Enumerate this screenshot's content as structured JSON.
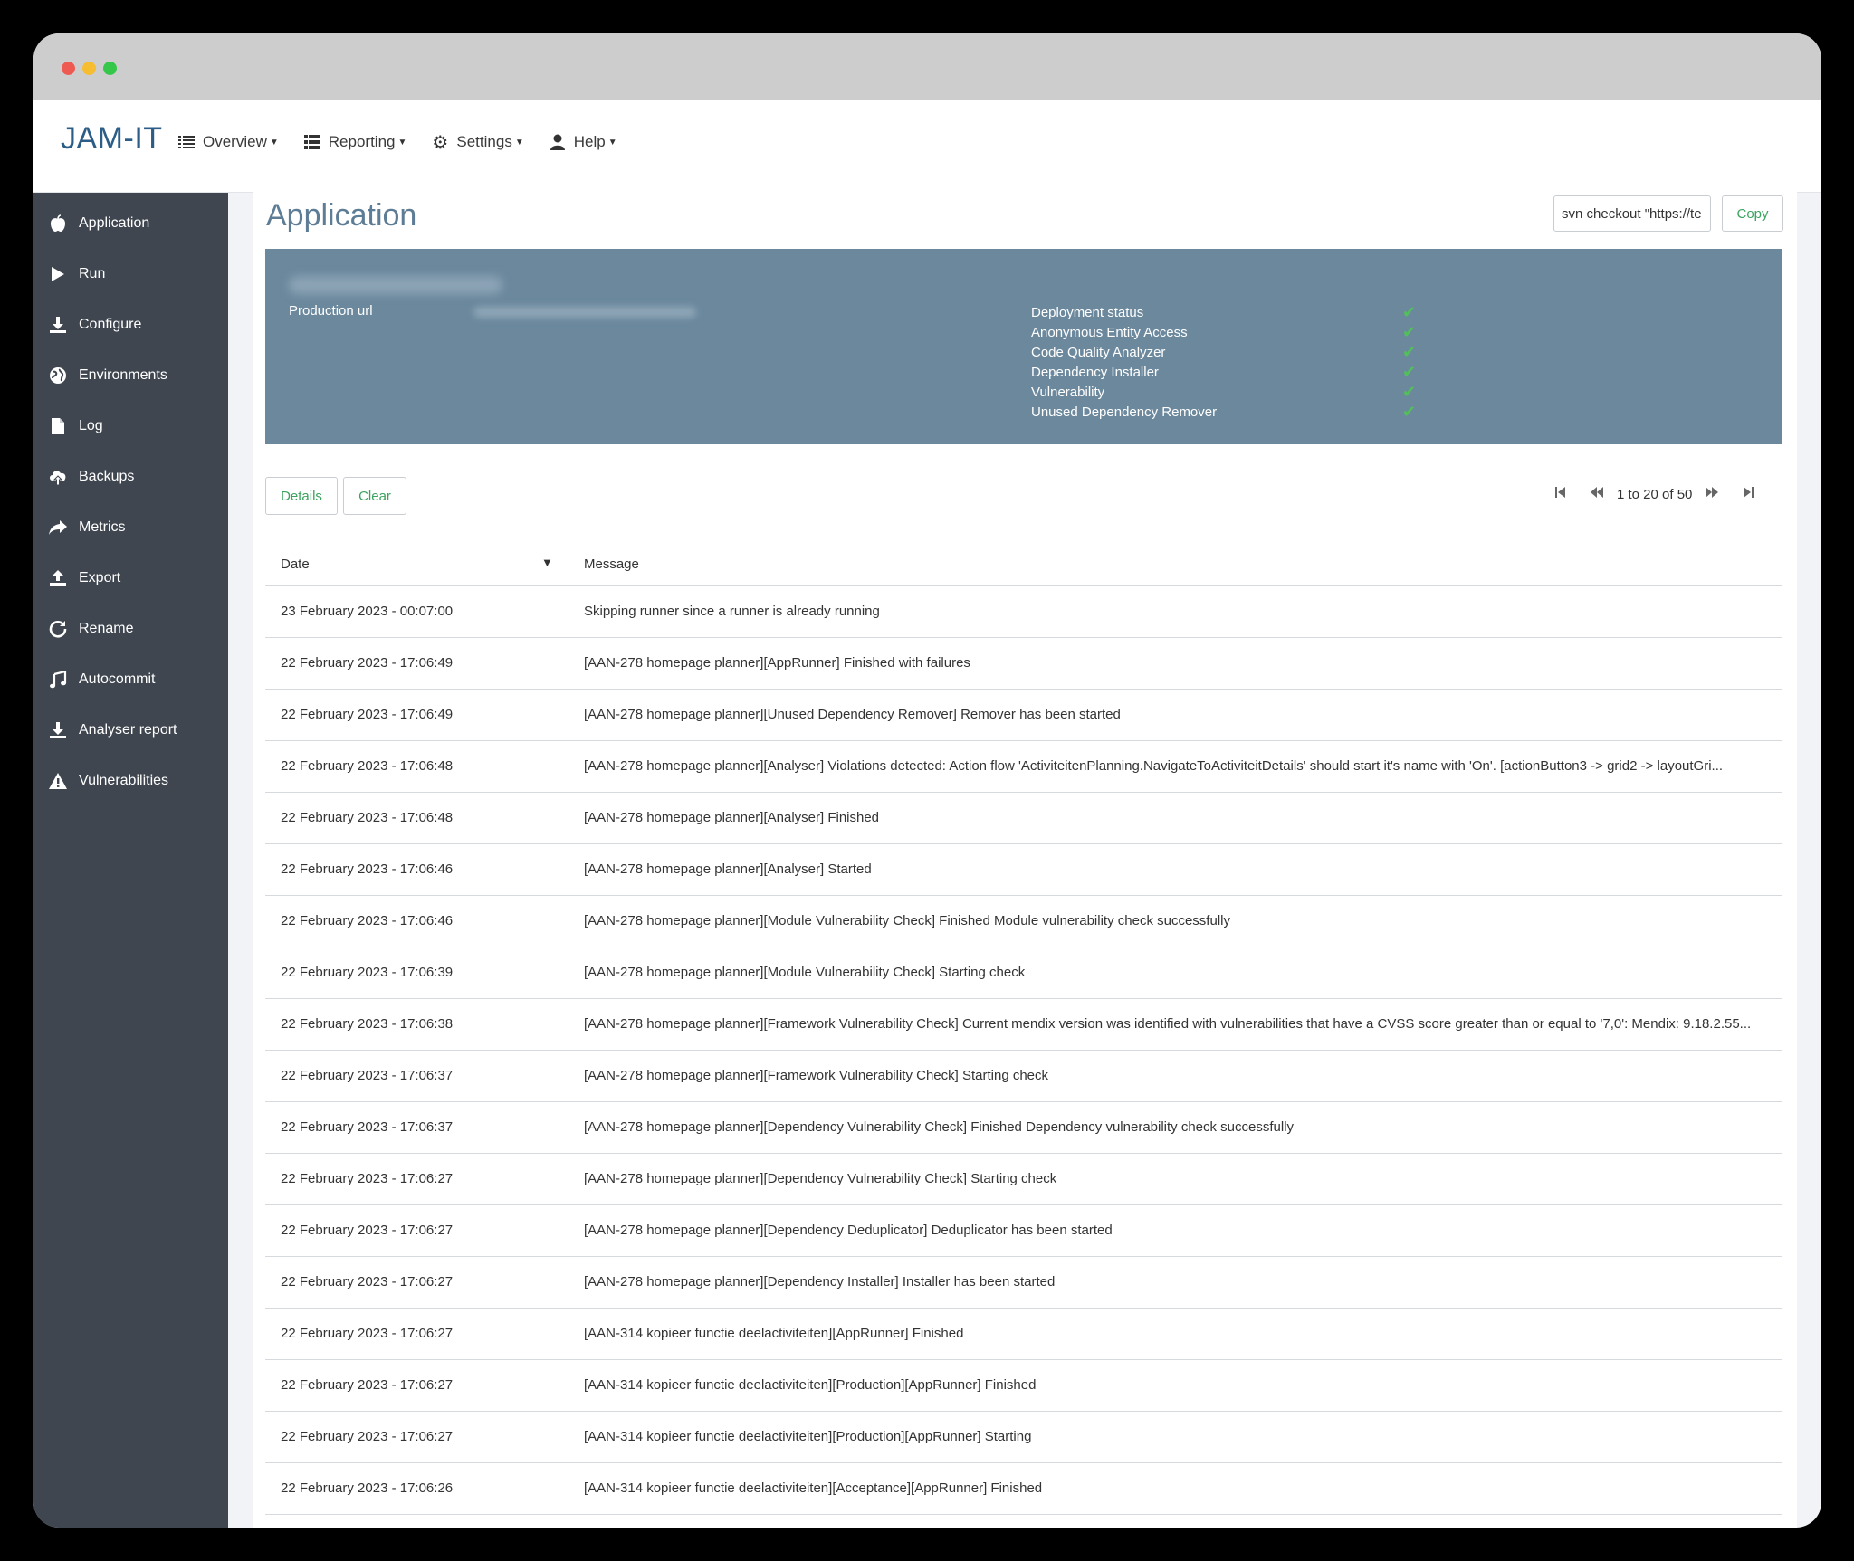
{
  "app": {
    "logo": "JAM-IT"
  },
  "nav": [
    {
      "label": "Overview",
      "icon": "list-icon"
    },
    {
      "label": "Reporting",
      "icon": "table-icon"
    },
    {
      "label": "Settings",
      "icon": "gear-icon"
    },
    {
      "label": "Help",
      "icon": "user-icon"
    }
  ],
  "sidebar": [
    {
      "label": "Application",
      "icon": "apple-icon"
    },
    {
      "label": "Run",
      "icon": "play-icon"
    },
    {
      "label": "Configure",
      "icon": "download-icon"
    },
    {
      "label": "Environments",
      "icon": "globe-icon"
    },
    {
      "label": "Log",
      "icon": "file-icon"
    },
    {
      "label": "Backups",
      "icon": "cloud-upload-icon"
    },
    {
      "label": "Metrics",
      "icon": "share-arrow-icon"
    },
    {
      "label": "Export",
      "icon": "export-icon"
    },
    {
      "label": "Rename",
      "icon": "refresh-icon"
    },
    {
      "label": "Autocommit",
      "icon": "music-note-icon"
    },
    {
      "label": "Analyser report",
      "icon": "download-icon"
    },
    {
      "label": "Vulnerabilities",
      "icon": "warning-icon"
    }
  ],
  "page": {
    "title": "Application",
    "svn_value": "svn checkout \"https://te",
    "copy_label": "Copy"
  },
  "info": {
    "production_url_label": "Production url",
    "statuses": [
      {
        "label": "Deployment status",
        "ok": true
      },
      {
        "label": "Anonymous Entity Access",
        "ok": true
      },
      {
        "label": "Code Quality Analyzer",
        "ok": true
      },
      {
        "label": "Dependency Installer",
        "ok": true
      },
      {
        "label": "Vulnerability",
        "ok": true
      },
      {
        "label": "Unused Dependency Remover",
        "ok": true
      }
    ],
    "check_glyph": "✔"
  },
  "actions": {
    "details_label": "Details",
    "clear_label": "Clear"
  },
  "pager": {
    "text": "1 to 20 of 50"
  },
  "table": {
    "headers": {
      "date": "Date",
      "message": "Message"
    },
    "rows": [
      {
        "date": "23 February 2023 - 00:07:00",
        "message": "Skipping runner since a runner is already running"
      },
      {
        "date": "22 February 2023 - 17:06:49",
        "message": "[AAN-278 homepage planner][AppRunner] Finished with failures"
      },
      {
        "date": "22 February 2023 - 17:06:49",
        "message": "[AAN-278 homepage planner][Unused Dependency Remover] Remover has been started"
      },
      {
        "date": "22 February 2023 - 17:06:48",
        "message": "[AAN-278 homepage planner][Analyser] Violations detected: Action flow 'ActiviteitenPlanning.NavigateToActiviteitDetails' should start it's name with 'On'. [actionButton3 -> grid2 -> layoutGri..."
      },
      {
        "date": "22 February 2023 - 17:06:48",
        "message": "[AAN-278 homepage planner][Analyser] Finished"
      },
      {
        "date": "22 February 2023 - 17:06:46",
        "message": "[AAN-278 homepage planner][Analyser] Started"
      },
      {
        "date": "22 February 2023 - 17:06:46",
        "message": "[AAN-278 homepage planner][Module Vulnerability Check] Finished Module vulnerability check successfully"
      },
      {
        "date": "22 February 2023 - 17:06:39",
        "message": "[AAN-278 homepage planner][Module Vulnerability Check] Starting check"
      },
      {
        "date": "22 February 2023 - 17:06:38",
        "message": "[AAN-278 homepage planner][Framework Vulnerability Check] Current mendix version was identified with vulnerabilities that have a CVSS score greater than or equal to '7,0': Mendix: 9.18.2.55..."
      },
      {
        "date": "22 February 2023 - 17:06:37",
        "message": "[AAN-278 homepage planner][Framework Vulnerability Check] Starting check"
      },
      {
        "date": "22 February 2023 - 17:06:37",
        "message": "[AAN-278 homepage planner][Dependency Vulnerability Check] Finished Dependency vulnerability check successfully"
      },
      {
        "date": "22 February 2023 - 17:06:27",
        "message": "[AAN-278 homepage planner][Dependency Vulnerability Check] Starting check"
      },
      {
        "date": "22 February 2023 - 17:06:27",
        "message": "[AAN-278 homepage planner][Dependency Deduplicator] Deduplicator has been started"
      },
      {
        "date": "22 February 2023 - 17:06:27",
        "message": "[AAN-278 homepage planner][Dependency Installer] Installer has been started"
      },
      {
        "date": "22 February 2023 - 17:06:27",
        "message": "[AAN-314 kopieer functie deelactiviteiten][AppRunner] Finished"
      },
      {
        "date": "22 February 2023 - 17:06:27",
        "message": "[AAN-314 kopieer functie deelactiviteiten][Production][AppRunner] Finished"
      },
      {
        "date": "22 February 2023 - 17:06:27",
        "message": "[AAN-314 kopieer functie deelactiviteiten][Production][AppRunner] Starting"
      },
      {
        "date": "22 February 2023 - 17:06:26",
        "message": "[AAN-314 kopieer functie deelactiviteiten][Acceptance][AppRunner] Finished"
      }
    ]
  }
}
